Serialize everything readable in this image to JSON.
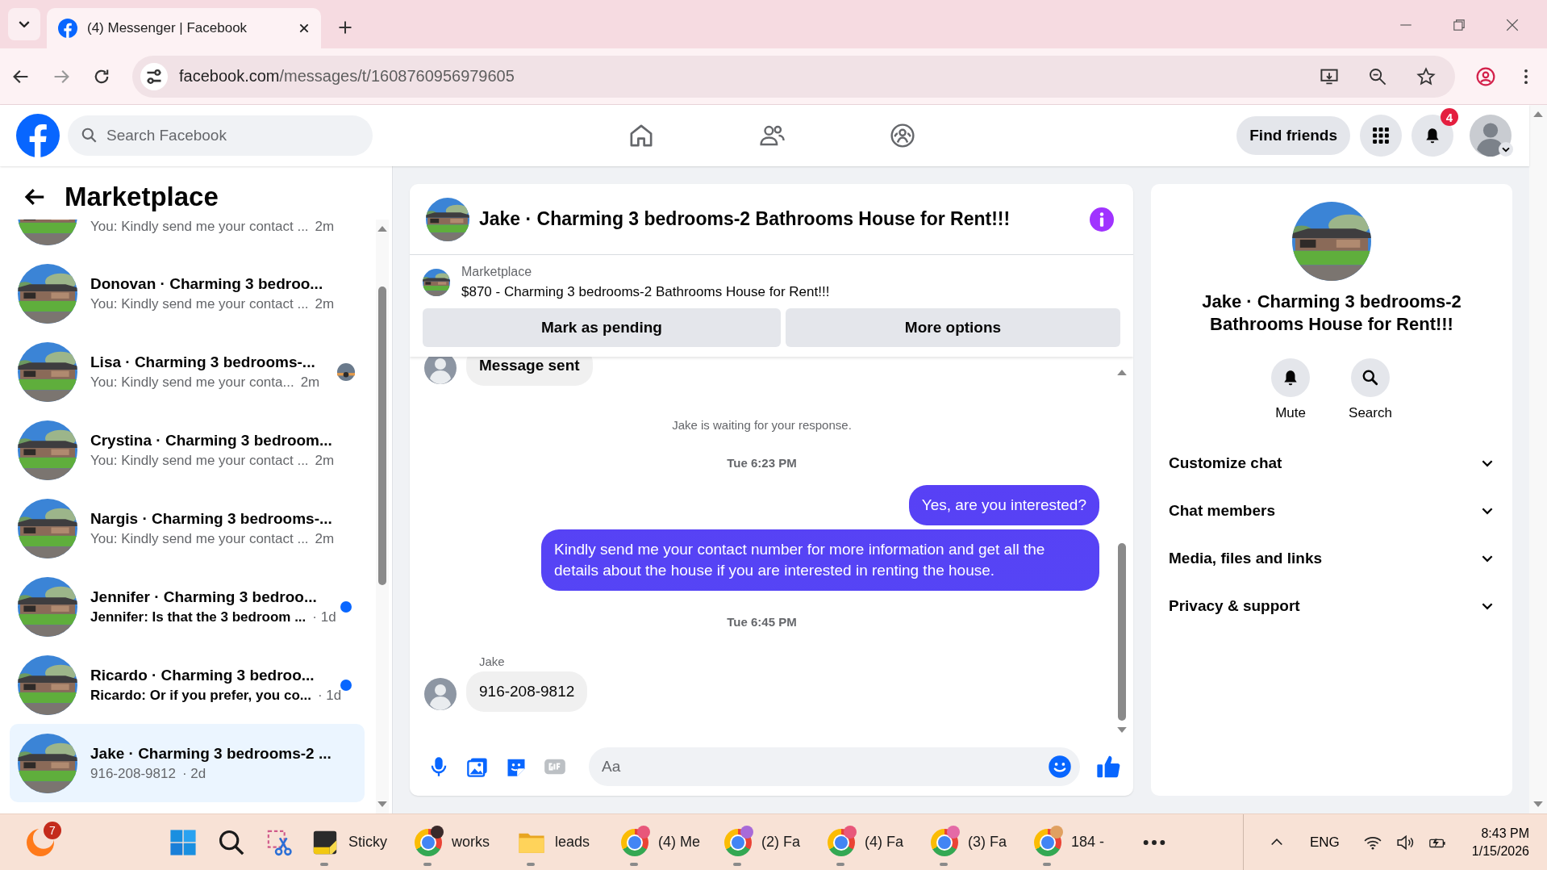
{
  "browser": {
    "tab": {
      "title": "(4) Messenger | Facebook"
    },
    "url": {
      "host": "facebook.com",
      "path": "/messages/t/1608760956979605"
    }
  },
  "header": {
    "search": {
      "placeholder": "Search Facebook"
    },
    "nav": [
      {
        "kind": "home"
      },
      {
        "kind": "friends"
      },
      {
        "kind": "groups"
      }
    ],
    "find_friends": "Find friends",
    "notifications_badge": "4"
  },
  "sidebar": {
    "title": "Marketplace",
    "conversations": [
      {
        "preview": "You: Kindly send me your contact ...",
        "time": "2m",
        "unread": false,
        "selected": false,
        "seen": false
      },
      {
        "title": "Donovan · Charming 3 bedroo...",
        "preview": "You: Kindly send me your contact ...",
        "time": "2m",
        "unread": false,
        "selected": false,
        "seen": false
      },
      {
        "title": "Lisa · Charming 3 bedrooms-...",
        "preview": "You: Kindly send me your conta...",
        "time": "2m",
        "unread": false,
        "selected": false,
        "seen": true
      },
      {
        "title": "Crystina · Charming 3 bedroom...",
        "preview": "You: Kindly send me your contact ...",
        "time": "2m",
        "unread": false,
        "selected": false,
        "seen": false
      },
      {
        "title": "Nargis · Charming 3 bedrooms-...",
        "preview": "You: Kindly send me your contact ...",
        "time": "2m",
        "unread": false,
        "selected": false,
        "seen": false
      },
      {
        "title": "Jennifer · Charming 3 bedroo...",
        "preview": "Jennifer: Is that the 3 bedroom ...",
        "time": "· 1d",
        "unread": true,
        "selected": false,
        "seen": false
      },
      {
        "title": "Ricardo · Charming 3 bedroo...",
        "preview": "Ricardo: Or if you prefer, you co...",
        "time": "· 1d",
        "unread": true,
        "selected": false,
        "seen": false
      },
      {
        "title": "Jake · Charming 3 bedrooms-2 ...",
        "preview": "916-208-9812",
        "time": "· 2d",
        "unread": false,
        "selected": true,
        "seen": false
      }
    ]
  },
  "chat": {
    "title": "Jake · Charming 3 bedrooms-2 Bathrooms House for Rent!!!",
    "listing": {
      "label": "Marketplace",
      "text": "$870 - Charming 3 bedrooms-2 Bathrooms House for Rent!!!"
    },
    "actions": [
      "Mark as pending",
      "More options"
    ],
    "messages": [
      {
        "kind": "incoming",
        "text": "Message sent"
      },
      {
        "kind": "notice",
        "text": "Jake is waiting for your response."
      },
      {
        "kind": "timestamp",
        "text": "Tue 6:23 PM"
      },
      {
        "kind": "outgoing",
        "text": "Yes, are you interested?"
      },
      {
        "kind": "outgoing",
        "text": "Kindly send me your contact number for more information and get all the details about the house if you are interested in renting the house."
      },
      {
        "kind": "timestamp",
        "text": "Tue 6:45 PM"
      },
      {
        "kind": "sender",
        "text": "Jake"
      },
      {
        "kind": "incoming",
        "text": "916-208-9812"
      }
    ],
    "composer": {
      "placeholder": "Aa"
    }
  },
  "panel": {
    "title": "Jake · Charming 3 bedrooms-2 Bathrooms House for Rent!!!",
    "actions": [
      {
        "kind": "mute",
        "label": "Mute"
      },
      {
        "kind": "search",
        "label": "Search"
      }
    ],
    "sections": [
      {
        "label": "Customize chat",
        "expanded": false
      },
      {
        "label": "Chat members",
        "expanded": false
      },
      {
        "label": "Media, files and links",
        "expanded": false
      },
      {
        "label": "Privacy & support",
        "expanded": false
      }
    ]
  },
  "taskbar": {
    "start_badge": "7",
    "apps": [
      {
        "kind": "start",
        "running": false
      },
      {
        "kind": "search",
        "running": false
      },
      {
        "kind": "snip",
        "running": false
      },
      {
        "kind": "sticky",
        "label": "Sticky",
        "running": true
      },
      {
        "kind": "browser",
        "label": "works",
        "color": "#3a2a2a",
        "running": true
      },
      {
        "kind": "folder",
        "label": "leads",
        "running": true
      },
      {
        "kind": "browser",
        "label": "(4) Me",
        "color": "#e8577a",
        "running": true
      },
      {
        "kind": "browser",
        "label": "(2) Fa",
        "color": "#a86ad8",
        "running": true
      },
      {
        "kind": "browser",
        "label": "(4) Fa",
        "color": "#e8577a",
        "running": true
      },
      {
        "kind": "browser",
        "label": "(3) Fa",
        "color": "#e46aa6",
        "running": true
      },
      {
        "kind": "browser",
        "label": "184 -",
        "color": "#e0a060",
        "running": true
      },
      {
        "kind": "more",
        "running": false
      }
    ],
    "tray": {
      "language": "ENG",
      "time": "8:43 PM",
      "date": "1/15/2026"
    }
  }
}
